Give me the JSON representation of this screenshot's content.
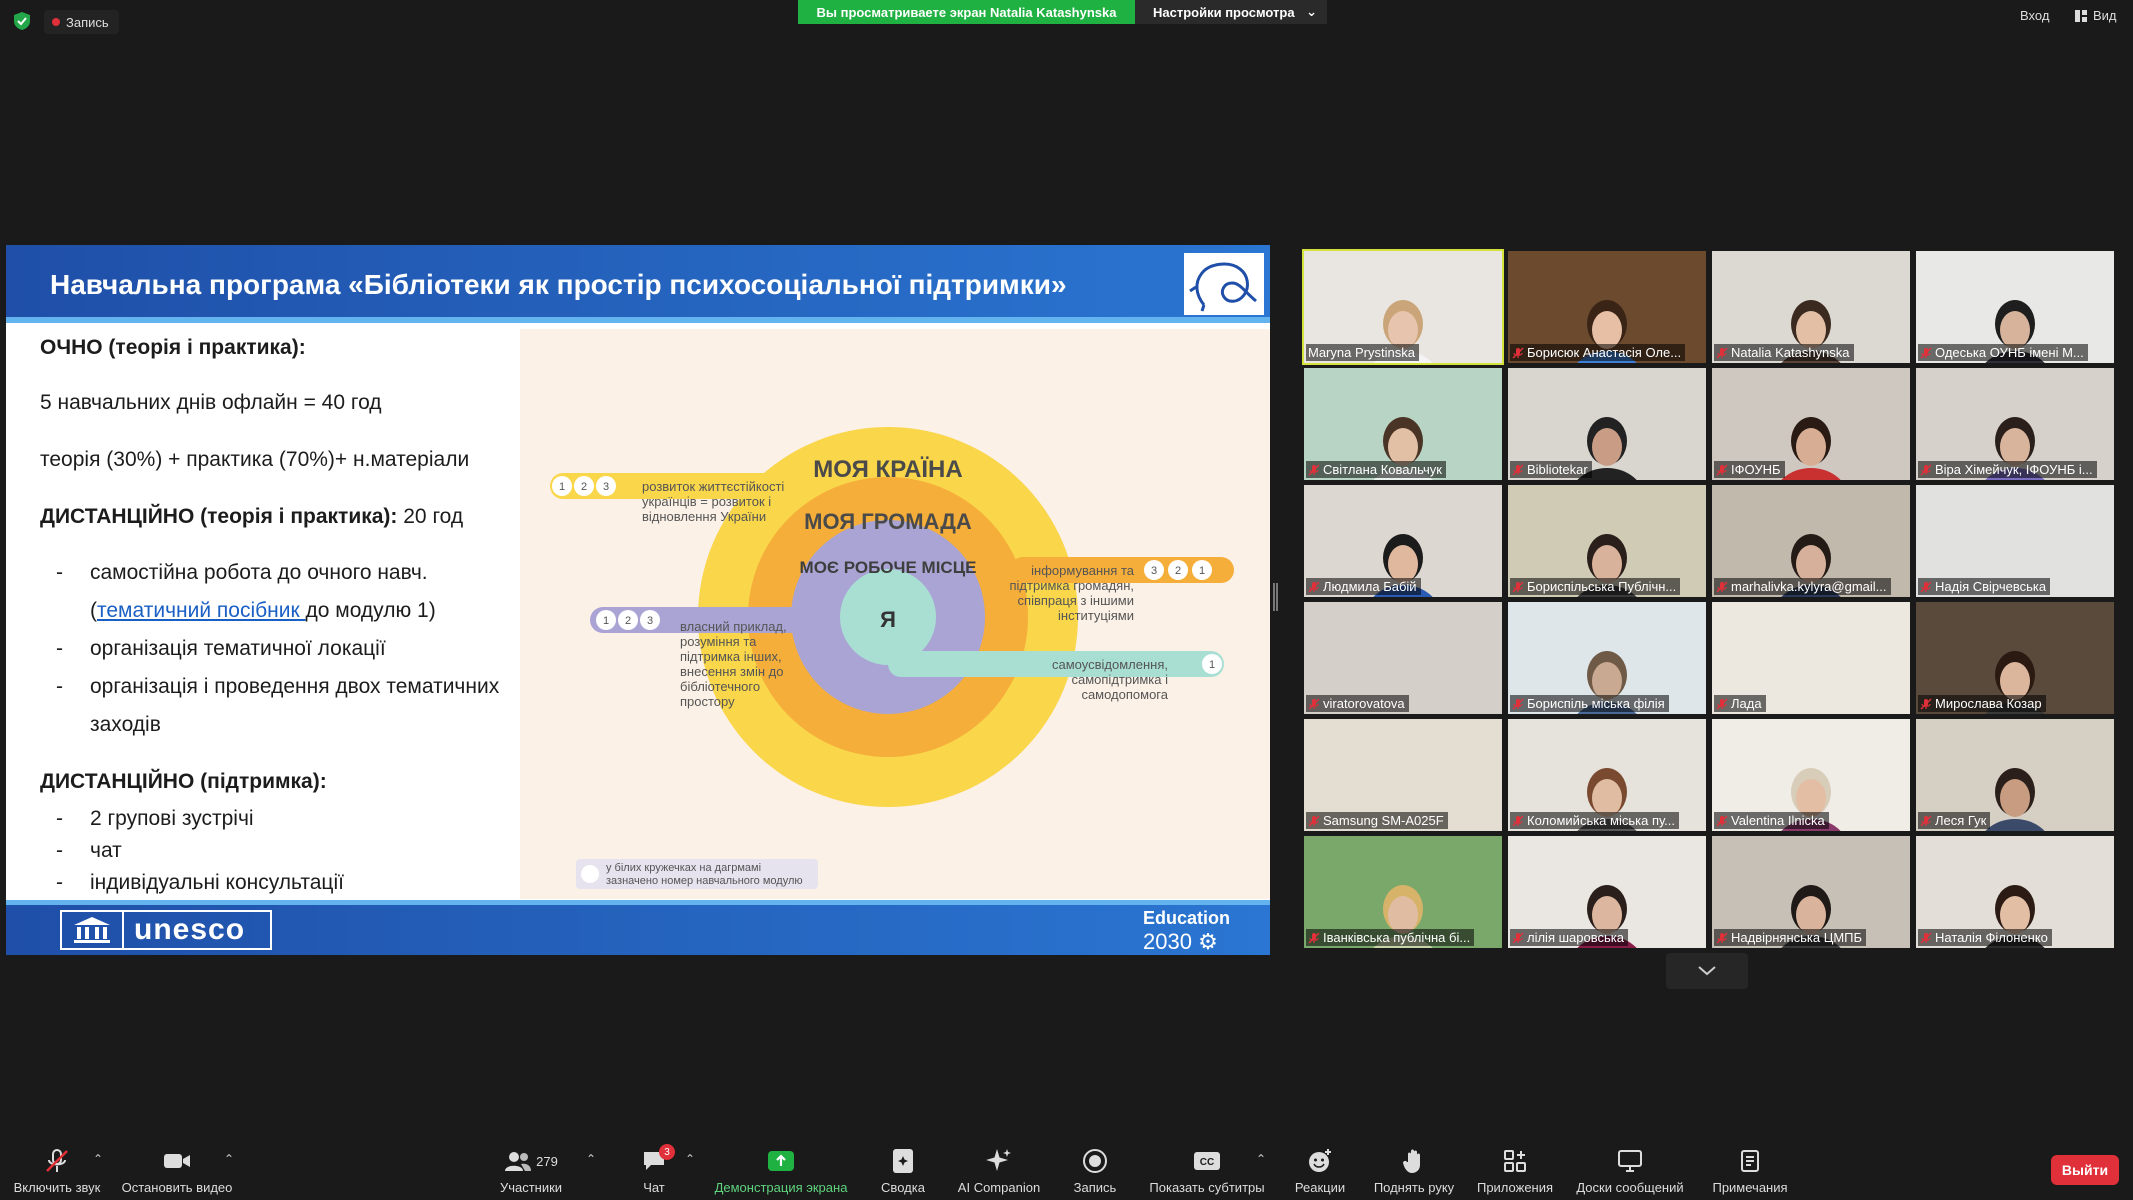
{
  "top": {
    "recording_label": "Запись",
    "share_banner": "Вы просматриваете экран Natalia Katashynska",
    "view_options": "Настройки просмотра",
    "enter_label": "Вход",
    "view_label": "Вид"
  },
  "slide": {
    "title": "Навчальна програма «Бібліотеки як простір психосоціальної підтримки»",
    "lines": {
      "l1": "ОЧНО (теорія і практика):",
      "l2": "5 навчальних днів офлайн  = 40 год",
      "l3": "теорія (30%) + практика (70%)+ н.матеріали",
      "l4a": "ДИСТАНЦІЙНО (теорія і практика):",
      "l4b": " 20 год",
      "b1": "самостійна робота до очного навч.",
      "b1b_pre": "(",
      "b1b_link": "тематичний посібник ",
      "b1b_post": "до модулю 1)",
      "b2": "організація тематичної локації",
      "b3": "організація і проведення двох тематичних",
      "b3b": "заходів",
      "l5": "ДИСТАНЦІЙНО (підтримка):",
      "b4": "2 групові зустрічі",
      "b5": "чат",
      "b6": "індивідуальні консультації",
      "dash": "-"
    },
    "diagram": {
      "ring1": "МОЯ КРАЇНА",
      "ring2": "МОЯ ГРОМАДА",
      "ring3": "МОЄ РОБОЧЕ МІСЦЕ",
      "center": "Я",
      "callout1": [
        "розвиток життєстійкості",
        "українців = розвиток і",
        "відновлення України"
      ],
      "callout2": [
        "інформування та",
        "підтримка громадян,",
        "співпраця з іншими",
        "інституціями"
      ],
      "callout3": [
        "власний приклад,",
        "розуміння та",
        "підтримка інших,",
        "внесення змін до",
        "бібліотечного",
        "простору"
      ],
      "callout4": [
        "самоусвідомлення,",
        "самопідтримка і",
        "самодопомога"
      ],
      "note": [
        "у білих кружечках на дагрмамі",
        "зазначено номер навчального модулю"
      ],
      "n1": "1",
      "n2": "2",
      "n3": "3"
    },
    "footer": {
      "unesco": "unesco",
      "edu1": "Education",
      "edu2": "2030"
    }
  },
  "participants": [
    {
      "name": "Maryna Prystinska",
      "muted": false,
      "active": true,
      "bg": "#e9e6e1",
      "skin": "#e7c4ad",
      "hair": "#caa57a",
      "shirt": "#f4f4f4"
    },
    {
      "name": "Борисюк Анастасія Оле...",
      "muted": true,
      "bg": "#6b4a2e",
      "skin": "#e6bfa4",
      "hair": "#3a2416",
      "shirt": "#3f7fd6"
    },
    {
      "name": "Natalia Katashynska",
      "muted": true,
      "bg": "#dcd8d2",
      "skin": "#e3bfa5",
      "hair": "#3a2a20",
      "shirt": "#5a4438"
    },
    {
      "name": "Одеська ОУНБ імені М...",
      "muted": true,
      "bg": "#e8e8e6",
      "skin": "#d6b39a",
      "hair": "#1e1e1e",
      "shirt": "#2f2f38"
    },
    {
      "name": "Світлана Ковальчук",
      "muted": true,
      "bg": "#b8d4c4",
      "skin": "#e2c0a6",
      "hair": "#4a3426",
      "shirt": "#eaf2ee"
    },
    {
      "name": "Bibliotekar",
      "muted": true,
      "bg": "#d9d6cf",
      "skin": "#c99d85",
      "hair": "#222",
      "shirt": "#222"
    },
    {
      "name": "ІФОУНБ",
      "muted": true,
      "bg": "#cfc8c0",
      "skin": "#d7ae94",
      "hair": "#2a1a14",
      "shirt": "#c93030"
    },
    {
      "name": "Віра Хімейчук, ІФОУНБ і...",
      "muted": true,
      "bg": "#d6d1cb",
      "skin": "#d9b49c",
      "hair": "#2a1f1a",
      "shirt": "#7b6dc1"
    },
    {
      "name": "Людмила Бабій",
      "muted": true,
      "bg": "#ddd7d1",
      "skin": "#e0b89e",
      "hair": "#1b1b1b",
      "shirt": "#2a5bb5"
    },
    {
      "name": "Бориспільська Публічн...",
      "muted": true,
      "bg": "#d0cbb5",
      "skin": "#d8b29a",
      "hair": "#2a1f1a",
      "shirt": "#3a3a3a"
    },
    {
      "name": "marhalivka.kylyra@gmail...",
      "muted": true,
      "bg": "#c2b9ad",
      "skin": "#d6b09a",
      "hair": "#241a16",
      "shirt": "#2b3a5a"
    },
    {
      "name": "Надія Свірчевська",
      "muted": true,
      "bg": "#e1e1df",
      "skin": "#e1e1df",
      "hair": "#e1e1df",
      "shirt": "#e1e1df"
    },
    {
      "name": "viratorovatova",
      "muted": true,
      "bg": "#d5cfc9",
      "skin": "#d5cfc9",
      "hair": "#d5cfc9",
      "shirt": "#d5cfc9"
    },
    {
      "name": "Бориспіль міська філія",
      "muted": true,
      "bg": "#dfe6ea",
      "skin": "#c9a991",
      "hair": "#6e5a47",
      "shirt": "#4b6a9a"
    },
    {
      "name": "Лада",
      "muted": true,
      "bg": "#ece7df",
      "skin": "#ece7df",
      "hair": "#ece7df",
      "shirt": "#ece7df"
    },
    {
      "name": "Мирослава Козар",
      "muted": true,
      "bg": "#5a4a3c",
      "skin": "#dcb59d",
      "hair": "#2a1a12",
      "shirt": "#3a3a3a"
    },
    {
      "name": "Samsung SM-A025F",
      "muted": true,
      "bg": "#e4ddd1",
      "skin": "#e4ddd1",
      "hair": "#e4ddd1",
      "shirt": "#e4ddd1"
    },
    {
      "name": "Коломийська міська пу...",
      "muted": true,
      "bg": "#e6e3dc",
      "skin": "#e0bca2",
      "hair": "#7a4a30",
      "shirt": "#5a5a5a"
    },
    {
      "name": "Valentina Ilnicka",
      "muted": true,
      "bg": "#f0ece6",
      "skin": "#e3bea4",
      "hair": "#d8cdb9",
      "shirt": "#8a3a6a"
    },
    {
      "name": "Леся Гук",
      "muted": true,
      "bg": "#d6cfc4",
      "skin": "#c89c80",
      "hair": "#2a1f1a",
      "shirt": "#3c4a6a"
    },
    {
      "name": "Іванківська публічна бі...",
      "muted": true,
      "bg": "#7aa86a",
      "skin": "#e0bca2",
      "hair": "#d7b36a",
      "shirt": "#c7d6a8"
    },
    {
      "name": "лілія шаровська",
      "muted": true,
      "bg": "#eae7e3",
      "skin": "#dcb69e",
      "hair": "#2a1f1a",
      "shirt": "#8a1c4a"
    },
    {
      "name": "Надвірнянська ЦМПБ",
      "muted": true,
      "bg": "#c7c0b6",
      "skin": "#d9b39b",
      "hair": "#1f1a17",
      "shirt": "#3a3a3a"
    },
    {
      "name": "Наталія Філоненко",
      "muted": true,
      "bg": "#e3ded7",
      "skin": "#e2bea5",
      "hair": "#2b1b14",
      "shirt": "#2c2c2c"
    }
  ],
  "toolbar": {
    "audio": "Включить звук",
    "video": "Остановить видео",
    "participants": "Участники",
    "participants_count": "279",
    "chat": "Чат",
    "chat_badge": "3",
    "share": "Демонстрация экрана",
    "summary": "Сводка",
    "ai": "AI Companion",
    "record": "Запись",
    "captions": "Показать субтитры",
    "reactions": "Реакции",
    "raise_hand": "Поднять руку",
    "apps": "Приложения",
    "whiteboards": "Доски сообщений",
    "notes": "Примечания",
    "leave": "Выйти"
  },
  "colors": {
    "share_green": "#1fb141",
    "leave_red": "#e0303a",
    "active_speaker": "#d4e33c",
    "slide_blue": "#2a76d2",
    "ring_outer": "#f9d64a",
    "ring_mid": "#f5ae3a",
    "ring_inner": "#a9a4d4",
    "ring_core": "#a9dfd3"
  }
}
